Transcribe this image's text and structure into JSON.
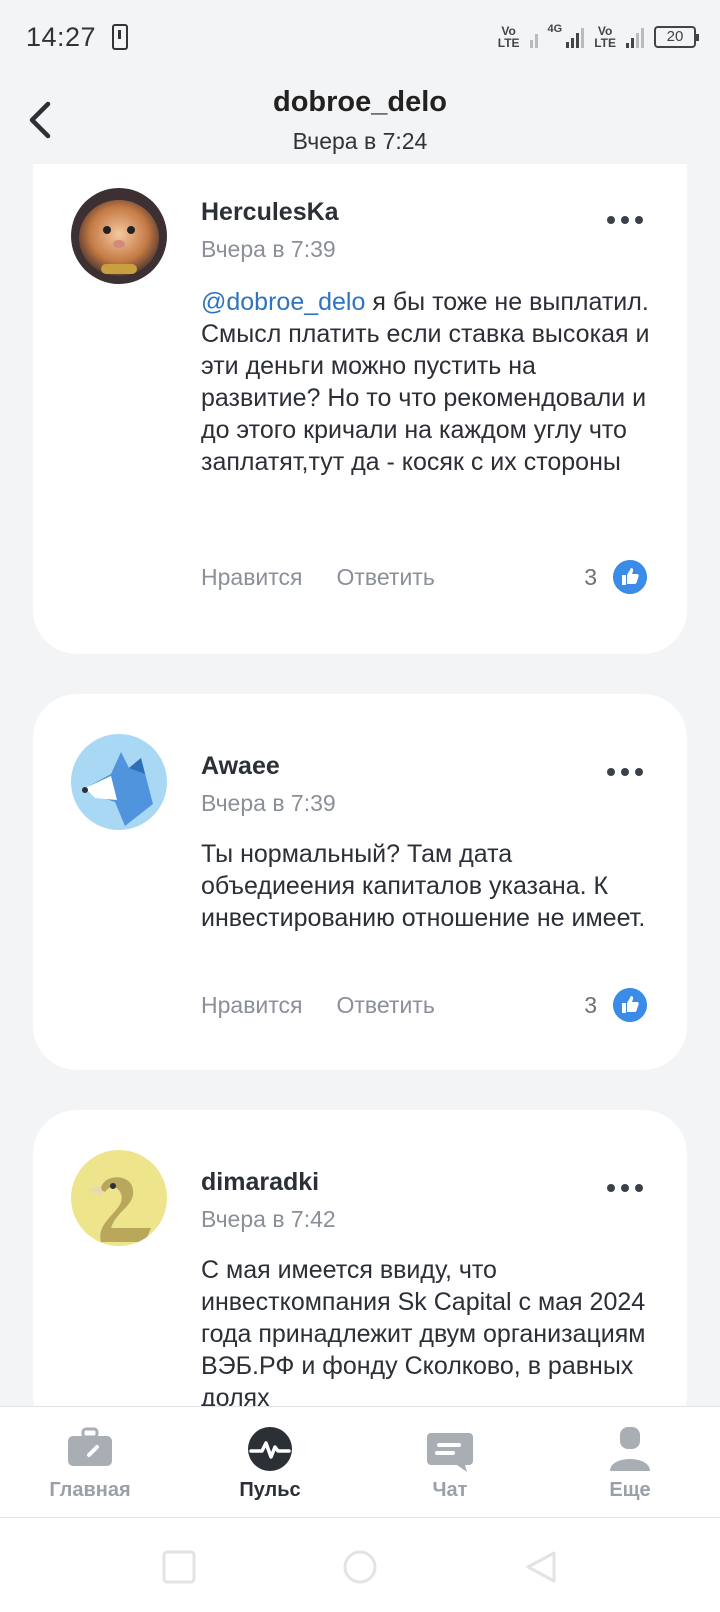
{
  "status_bar": {
    "time": "14:27",
    "volte1": "Vo\nLTE",
    "network": "4G",
    "volte2": "Vo\nLTE",
    "battery": "20"
  },
  "header": {
    "title": "dobroe_delo",
    "subtitle": "Вчера в 7:24"
  },
  "comments": [
    {
      "author": "HerculesKa",
      "time": "Вчера в 7:39",
      "mention": "@dobroe_delo",
      "text": " я бы тоже не выплатил. Смысл платить если ставка высокая и эти деньги можно пустить на развитие? Но то что рекомендовали и до этого кричали на каждом углу что заплатят,тут да - косяк с их стороны",
      "like_label": "Нравится",
      "reply_label": "Ответить",
      "likes": "3"
    },
    {
      "author": "Awaee",
      "time": "Вчера в 7:39",
      "text": "Ты нормальный? Там дата объедиеения капиталов указана. К инвестированию отношение не имеет.",
      "like_label": "Нравится",
      "reply_label": "Ответить",
      "likes": "3"
    },
    {
      "author": "dimaradki",
      "time": "Вчера в 7:42",
      "text": "С мая имеется ввиду, что инвесткомпания Sk Capital с мая 2024 года принадлежит двум организациям ВЭБ.РФ и фонду Сколково, в равных долях"
    }
  ],
  "bottom_nav": [
    {
      "label": "Главная",
      "icon": "briefcase-icon"
    },
    {
      "label": "Пульс",
      "icon": "pulse-icon"
    },
    {
      "label": "Чат",
      "icon": "chat-icon"
    },
    {
      "label": "Еще",
      "icon": "profile-icon"
    }
  ],
  "colors": {
    "accent": "#3b8ce8",
    "mention": "#2f74c0",
    "muted": "#8a8f98"
  }
}
